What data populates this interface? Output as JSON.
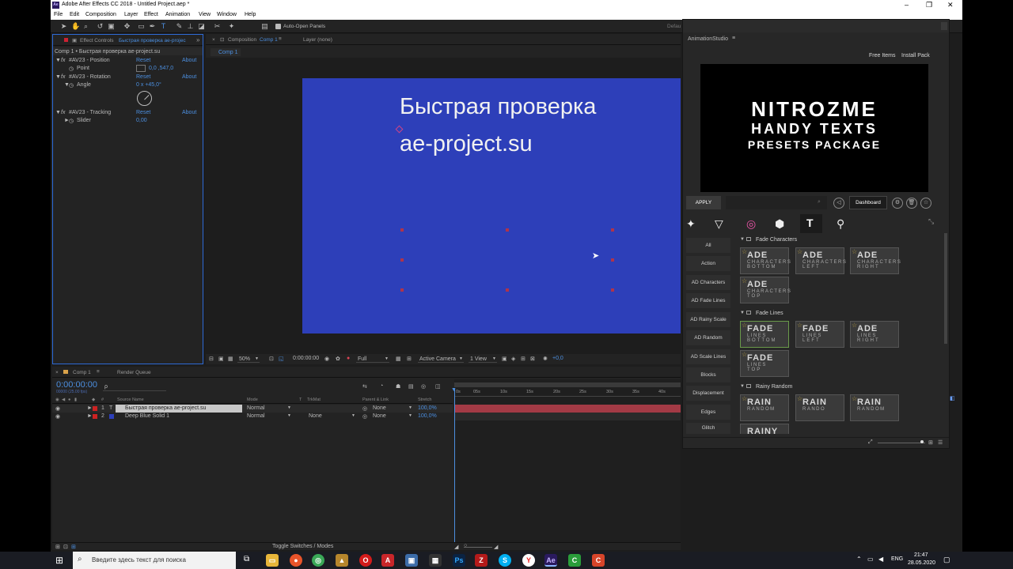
{
  "window": {
    "title": "Adobe After Effects CC 2018 - Untitled Project.aep *",
    "controls": [
      "–",
      "❐",
      "✕"
    ]
  },
  "menu": [
    "File",
    "Edit",
    "Composition",
    "Layer",
    "Effect",
    "Animation",
    "View",
    "Window",
    "Help"
  ],
  "toolbar": {
    "auto_open": "Auto-Open Panels",
    "workspace": "Defau"
  },
  "effect_controls": {
    "tab": "Effect Controls",
    "tab_layer": "Быстрая проверка  ae-projec",
    "breadcrumb": "Comp 1 • Быстрая проверка  ae-project.su",
    "effects": [
      {
        "name": "#AV23 - Position",
        "reset": "Reset",
        "about": "About",
        "prop": "Point",
        "value": "0,0 ,547,0"
      },
      {
        "name": "#AV23 - Rotation",
        "reset": "Reset",
        "about": "About",
        "prop": "Angle",
        "value": "0 x +45,0°"
      },
      {
        "name": "#AV23 - Tracking",
        "reset": "Reset",
        "about": "About",
        "prop": "Slider",
        "value": "0,00"
      }
    ]
  },
  "composition": {
    "tab": "Composition",
    "tab_comp": "Comp 1",
    "layer_tab": "Layer  (none)",
    "subtab": "Comp 1",
    "text_line1": "Быстрая проверка",
    "text_line2": "ae-project.su",
    "zoom": "50%",
    "timecode": "0:00:00:00",
    "resolution": "Full",
    "camera": "Active Camera",
    "view": "1 View",
    "exposure": "+0,0"
  },
  "timeline": {
    "tab": "Comp 1",
    "render_queue": "Render Queue",
    "timecode": "0:00:00:00",
    "fps": "00000 (25.00 fps)",
    "search_placeholder": "ρ",
    "columns": [
      "Source Name",
      "Mode",
      "T",
      "TrkMat",
      "Parent & Link",
      "Stretch"
    ],
    "col_num": "#",
    "layers": [
      {
        "num": "1",
        "type": "T",
        "name": "Быстрая проверка  ae-project.su",
        "mode": "Normal",
        "trkmat": "",
        "parent": "None",
        "stretch": "100,0%"
      },
      {
        "num": "2",
        "type": "",
        "name": "Deep Blue Solid 1",
        "mode": "Normal",
        "trkmat": "None",
        "parent": "None",
        "stretch": "100,0%"
      }
    ],
    "ruler": [
      "0s",
      "05s",
      "10s",
      "15s",
      "20s",
      "25s",
      "30s",
      "35s",
      "40s"
    ],
    "toggle": "Toggle Switches / Modes"
  },
  "animation_studio": {
    "title": "AnimationStudio",
    "free_items": "Free Items",
    "install_pack": "Install Pack",
    "banner": [
      "NITROZME",
      "HANDY TEXTS",
      "PRESETS PACKAGE"
    ],
    "apply": "APPLY",
    "dashboard": "Dashboard",
    "categories": [
      "All",
      "Action",
      "AD Characters",
      "AD Fade Lines",
      "AD Rainy Scale",
      "AD Random",
      "AD Scale Lines",
      "Blocks",
      "Displacement",
      "Edges",
      "Glitch"
    ],
    "sections": [
      {
        "title": "Fade Characters",
        "cards": [
          {
            "t1": "ADE",
            "t2": "CHARACTERS",
            "t3": "BOTTOM"
          },
          {
            "t1": "ADE",
            "t2": "CHARACTERS",
            "t3": "LEFT"
          },
          {
            "t1": "ADE",
            "t2": "CHARACTERS",
            "t3": "RIGHT"
          },
          {
            "t1": "ADE",
            "t2": "CHARACTERS",
            "t3": "TOP"
          }
        ]
      },
      {
        "title": "Fade Lines",
        "cards": [
          {
            "t1": "FADE",
            "t2": "LINES",
            "t3": "BOTTOM"
          },
          {
            "t1": "FADE",
            "t2": "LINES",
            "t3": "LEFT"
          },
          {
            "t1": "ADE",
            "t2": "LINES",
            "t3": "RIGHT"
          },
          {
            "t1": "FADE",
            "t2": "LINES",
            "t3": "TOP"
          }
        ]
      },
      {
        "title": "Rainy Random",
        "cards": [
          {
            "t1": "RAIN",
            "t2": "RANDOM",
            "t3": ""
          },
          {
            "t1": "RAIN",
            "t2": "RANDO",
            "t3": ""
          },
          {
            "t1": "RAIN",
            "t2": "RANDOM",
            "t3": ""
          },
          {
            "t1": "RAINY",
            "t2": "",
            "t3": ""
          }
        ]
      }
    ]
  },
  "taskbar": {
    "search_placeholder": "Введите здесь текст для поиска",
    "lang": "ENG",
    "time": "21:47",
    "date": "28.05.2020"
  },
  "colors": {
    "comp_bg": "#2d3fb9",
    "accent": "#4c8fe0",
    "layer_bar": "#a33a45",
    "taskbar": "#1a1c23"
  }
}
